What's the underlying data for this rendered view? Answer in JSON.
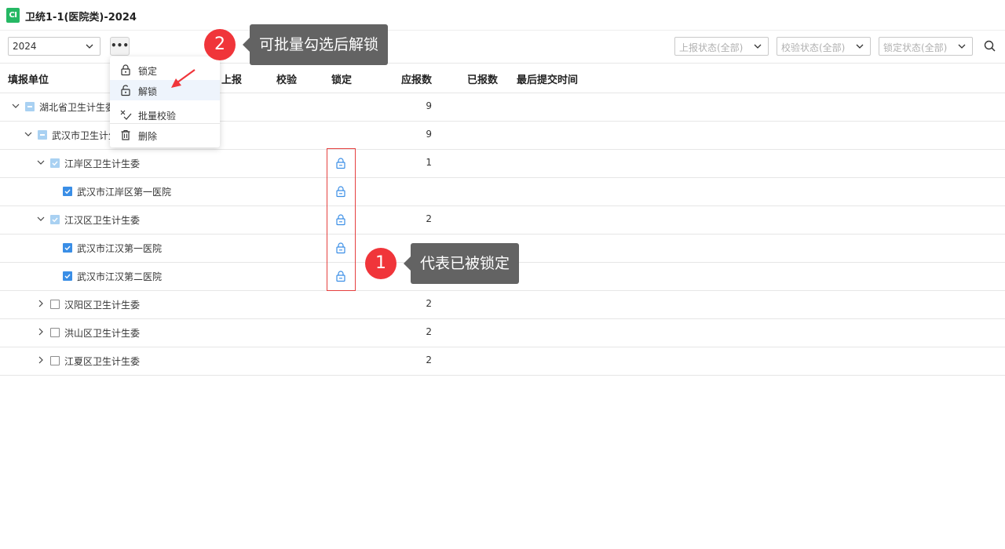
{
  "window": {
    "title": "卫统1-1(医院类)-2024",
    "logo_text": "CI"
  },
  "toolbar": {
    "year_value": "2024",
    "more_label": "•••",
    "filters": [
      "上报状态(全部)",
      "校验状态(全部)",
      "锁定状态(全部)"
    ]
  },
  "menu": {
    "items": [
      {
        "label": "锁定",
        "icon": "lock-icon"
      },
      {
        "label": "解锁",
        "icon": "unlock-icon"
      },
      {
        "label": "批量校验",
        "icon": "batch-check-icon"
      },
      {
        "label": "删除",
        "icon": "trash-icon"
      }
    ]
  },
  "table": {
    "headers": {
      "unit": "填报单位",
      "report": "上报",
      "check": "校验",
      "lock": "锁定",
      "due": "应报数",
      "reported": "已报数",
      "last_time": "最后提交时间"
    },
    "rows": [
      {
        "name": "湖北省卫生计生委",
        "due": "9"
      },
      {
        "name": "武汉市卫生计生委",
        "due": "9"
      },
      {
        "name": "江岸区卫生计生委",
        "due": "1"
      },
      {
        "name": "武汉市江岸区第一医院",
        "due": ""
      },
      {
        "name": "江汉区卫生计生委",
        "due": "2"
      },
      {
        "name": "武汉市江汉第一医院",
        "due": ""
      },
      {
        "name": "武汉市江汉第二医院",
        "due": ""
      },
      {
        "name": "汉阳区卫生计生委",
        "due": "2"
      },
      {
        "name": "洪山区卫生计生委",
        "due": "2"
      },
      {
        "name": "江夏区卫生计生委",
        "due": "2"
      }
    ]
  },
  "annotations": {
    "badge1": "1",
    "callout1": "代表已被锁定",
    "badge2": "2",
    "callout2": "可批量勾选后解锁"
  },
  "colors": {
    "accent": "#3a8ee6",
    "annotation_red": "#f0353a",
    "logo_green": "#25b864"
  }
}
